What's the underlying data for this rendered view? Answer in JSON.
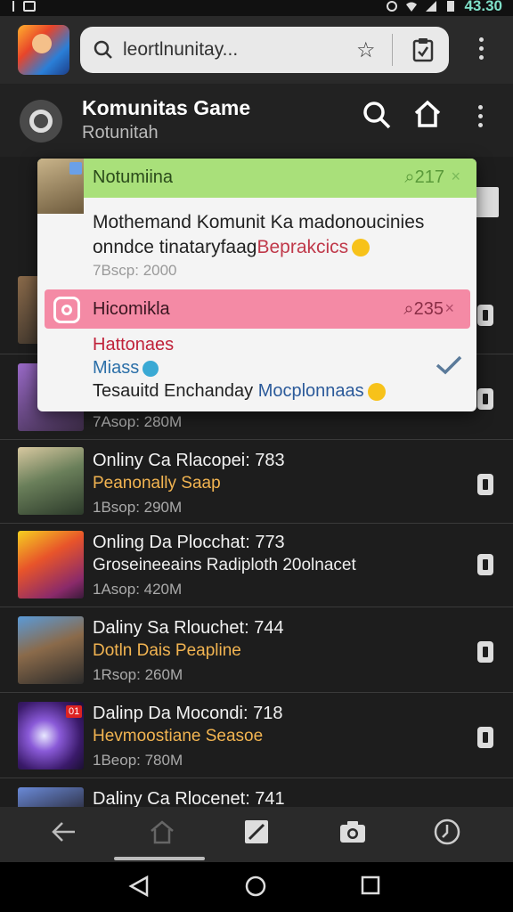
{
  "status_bar": {
    "time": "43.30"
  },
  "browser": {
    "url": "leortlnunitay..."
  },
  "app_header": {
    "title": "Komunitas Game",
    "subtitle": "Rotunitah"
  },
  "popup": {
    "notif1": {
      "title": "Notumiina",
      "count": "217",
      "line1": "Mothemand Komunit Ka madonoucinies",
      "line2_start": "onndce tinataryfaag",
      "line2_highlight": "Beprakcics",
      "meta": "7Bscp: 2000"
    },
    "notif2": {
      "title": "Hicomikla",
      "count": "235",
      "line1": "Hattonaes",
      "line2": "Miass",
      "line3_start": "Tesauitd Enchanday",
      "line3_highlight": "Mocplonnaas"
    }
  },
  "list": {
    "rows": [
      {
        "meta": "7Asop: 280M"
      },
      {
        "title": "Onliny Ca Rlacopei: 783",
        "subtitle": "Peanonally Saap",
        "meta": "1Bsop: 290M",
        "subtitle_color": "#f2b451"
      },
      {
        "title": "Onling Da Plocchat: 773",
        "subtitle": "Groseineeains Radiploth 20olnacet",
        "meta": "1Asop: 420M",
        "subtitle_color": "#eeeeee"
      },
      {
        "title": "Daliny Sa Rlouchet: 744",
        "subtitle": "Dotln Dais Peapline",
        "meta": "1Rsop: 260M",
        "subtitle_color": "#f2b451"
      },
      {
        "title": "Dalinp Da Mocondi: 718",
        "subtitle": "Hevmoostiane Seasoe",
        "meta": "1Beop: 780M",
        "subtitle_color": "#f2b451"
      },
      {
        "title": "Daliny Ca Rlocenet: 741"
      }
    ],
    "thumb_badge": "01"
  },
  "icons": [
    "search-icon",
    "star-icon",
    "clipboard-icon",
    "menu-icon",
    "home-icon",
    "back-icon",
    "edit-icon",
    "camera-icon",
    "clock-icon",
    "triangle-back",
    "circle-home",
    "square-recents"
  ]
}
